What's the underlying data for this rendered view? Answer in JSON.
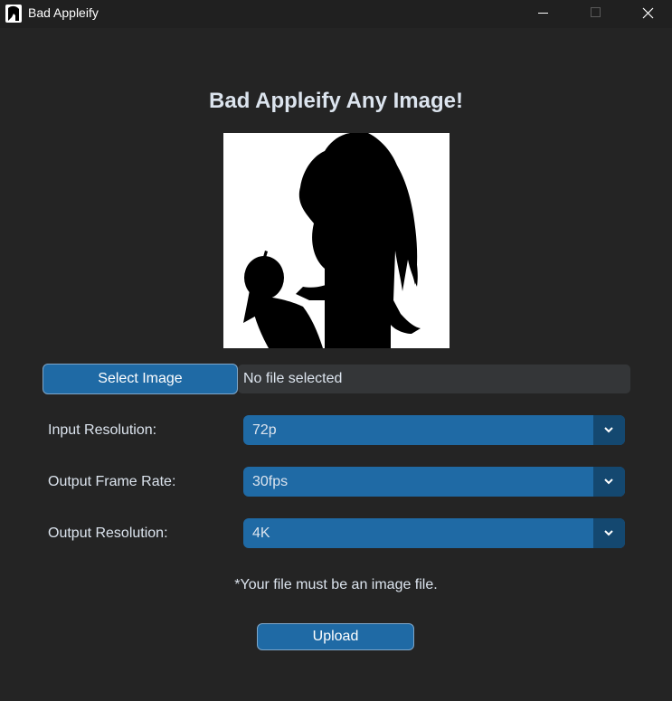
{
  "window": {
    "title": "Bad Appleify",
    "icon": "bad-apple-silhouette-icon",
    "controls": [
      "minimize-icon",
      "maximize-icon",
      "close-icon"
    ]
  },
  "main": {
    "heading": "Bad Appleify Any Image!",
    "select_button": "Select Image",
    "file_status": "No file selected",
    "settings": [
      {
        "label": "Input Resolution:",
        "value": "72p"
      },
      {
        "label": "Output Frame Rate:",
        "value": "30fps"
      },
      {
        "label": "Output Resolution:",
        "value": "4K"
      }
    ],
    "note": "*Your file must be an image file.",
    "upload_button": "Upload"
  },
  "colors": {
    "background": "#242424",
    "titlebar": "#202020",
    "accent": "#1f6aa5",
    "accent_dark": "#144870",
    "field": "#343638",
    "text": "#dce4ee"
  }
}
